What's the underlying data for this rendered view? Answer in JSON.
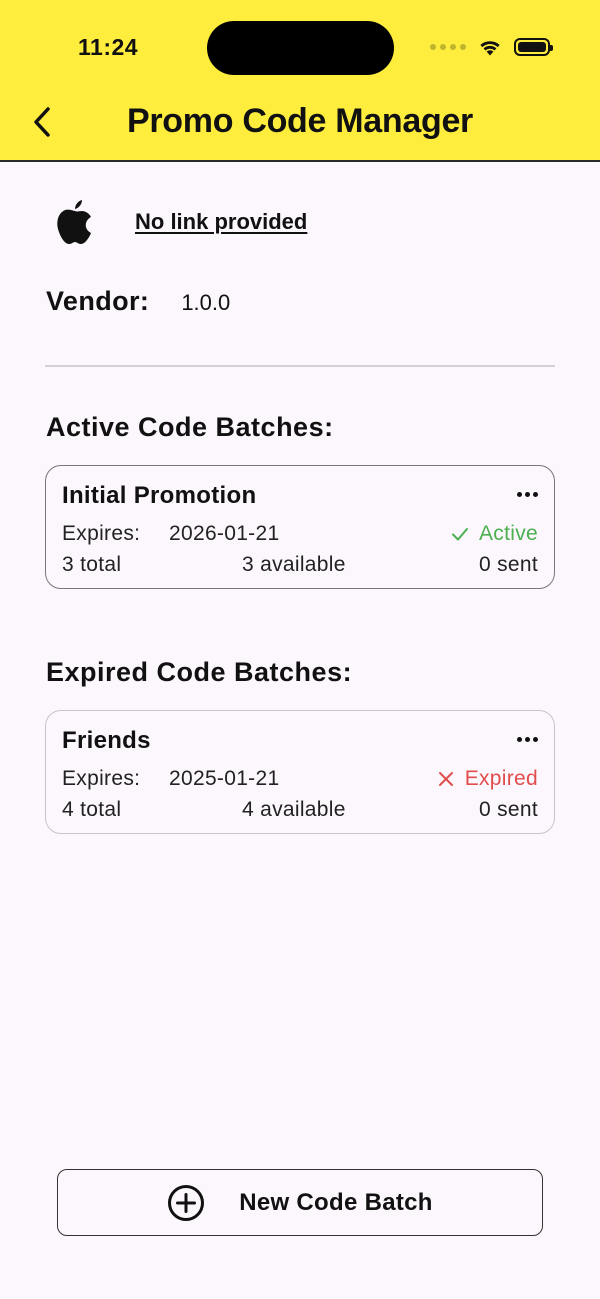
{
  "status_bar": {
    "time": "11:24"
  },
  "nav": {
    "title": "Promo Code Manager",
    "back_icon": "chevron-left-icon"
  },
  "app": {
    "icon": "apple-logo-icon",
    "link_text": "No link provided"
  },
  "vendor": {
    "label": "Vendor:",
    "value": "1.0.0"
  },
  "active_section": {
    "title": "Active Code Batches:",
    "batches": [
      {
        "name": "Initial Promotion",
        "expires_label": "Expires:",
        "expires_date": "2026-01-21",
        "status": "Active",
        "status_icon": "check-icon",
        "total": "3 total",
        "available": "3 available",
        "sent": "0 sent"
      }
    ]
  },
  "expired_section": {
    "title": "Expired Code Batches:",
    "batches": [
      {
        "name": "Friends",
        "expires_label": "Expires:",
        "expires_date": "2025-01-21",
        "status": "Expired",
        "status_icon": "x-icon",
        "total": "4 total",
        "available": "4 available",
        "sent": "0 sent"
      }
    ]
  },
  "new_batch_button": {
    "label": "New Code Batch",
    "icon": "plus-circle-icon"
  },
  "colors": {
    "header_bg": "#ffed3d",
    "page_bg": "#fcf7fc",
    "active_green": "#4caf50",
    "expired_red": "#e14d4d"
  }
}
